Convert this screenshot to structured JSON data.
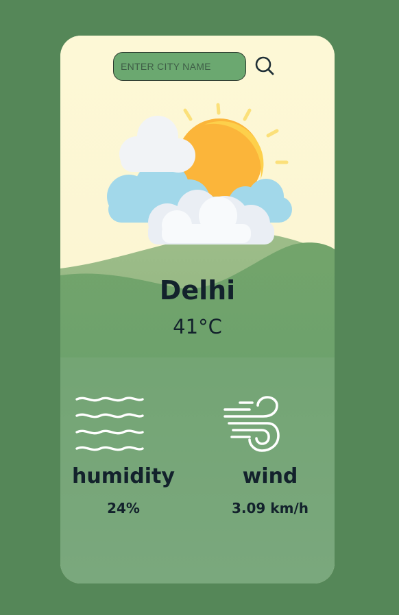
{
  "search": {
    "placeholder": "ENTER CITY NAME",
    "value": "",
    "button_icon": "search-icon"
  },
  "weather": {
    "icon": "partly-cloudy-sun-icon",
    "city": "Delhi",
    "temperature": "41°C"
  },
  "stats": {
    "humidity": {
      "icon": "humidity-waves-icon",
      "label": "humidity",
      "value": "24%"
    },
    "wind": {
      "icon": "wind-icon",
      "label": "wind",
      "value": "3.09 km/h"
    }
  },
  "colors": {
    "page_background": "#558758",
    "card_top": "#fdf7d4",
    "card_hills": "#7aa87c",
    "search_field": "#6ba870",
    "text": "#13222c"
  }
}
